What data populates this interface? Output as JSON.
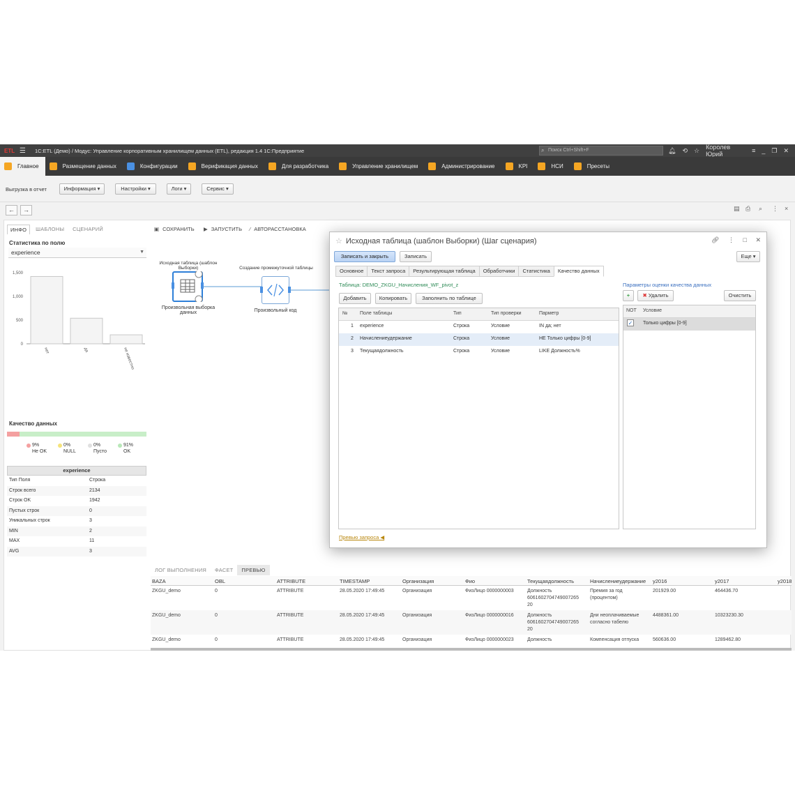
{
  "titlebar": {
    "logo": "ETL",
    "title": "1С:ETL (Демо) / Модус: Управление корпоративным хранилищем данных (ETL), редакция 1.4 1С:Предприятие",
    "search_placeholder": "Поиск Ctrl+Shift+F",
    "user": "Королев Юрий"
  },
  "mainnav": [
    {
      "label": "Главное",
      "icon": "home-icon",
      "color": "#f5a623"
    },
    {
      "label": "Размещение данных",
      "icon": "database-icon",
      "color": "#f5a623"
    },
    {
      "label": "Конфигурации",
      "icon": "hierarchy-icon",
      "color": "#4a90e2"
    },
    {
      "label": "Верификация данных",
      "icon": "wand-icon",
      "color": "#f5a623"
    },
    {
      "label": "Для разработчика",
      "icon": "code-icon",
      "color": "#f5a623"
    },
    {
      "label": "Управление хранилищем",
      "icon": "storage-icon",
      "color": "#f5a623"
    },
    {
      "label": "Администрирование",
      "icon": "gear-icon",
      "color": "#f5a623"
    },
    {
      "label": "KPI",
      "icon": "bar-chart-icon",
      "color": "#f5a623"
    },
    {
      "label": "НСИ",
      "icon": "book-icon",
      "color": "#f5a623"
    },
    {
      "label": "Пресеты",
      "icon": "sliders-icon",
      "color": "#f5a623"
    }
  ],
  "cmdbar": {
    "label": "Выгрузка в отчет",
    "buttons": [
      "Информация ▾",
      "Настройки ▾",
      "Логи ▾",
      "Сервис ▾"
    ]
  },
  "leftpanel": {
    "tabs": [
      "ИНФО",
      "ШАБЛОНЫ",
      "СЦЕНАРИЙ"
    ],
    "field_stats_title": "Статистика по полю",
    "field_selected": "experience",
    "quality_title": "Качество данных",
    "legend": [
      {
        "pct": "9%",
        "label": "Не OK",
        "color": "#f4a0a0"
      },
      {
        "pct": "0%",
        "label": "NULL",
        "color": "#f5e37a"
      },
      {
        "pct": "0%",
        "label": "Пусто",
        "color": "#e0e0e0"
      },
      {
        "pct": "91%",
        "label": "OK",
        "color": "#b8e8b8"
      }
    ],
    "quality_bad_fraction": 0.09,
    "stats_header": "experience",
    "stats": [
      {
        "k": "Тип Поля",
        "v": "Строка"
      },
      {
        "k": "Строк всего",
        "v": "2134"
      },
      {
        "k": "Строк OK",
        "v": "1942"
      },
      {
        "k": "Пустых строк",
        "v": "0"
      },
      {
        "k": "Уникальных строк",
        "v": "3"
      },
      {
        "k": "MIN",
        "v": "2"
      },
      {
        "k": "MAX",
        "v": "11"
      },
      {
        "k": "AVG",
        "v": "3"
      }
    ]
  },
  "chart_data": {
    "type": "bar",
    "categories": [
      "нет",
      "да",
      "не известно"
    ],
    "values": [
      1420,
      540,
      190
    ],
    "yticks": [
      "0",
      "500",
      "1,000",
      "1,500"
    ],
    "ylim": [
      0,
      1500
    ]
  },
  "center": {
    "toolbar": [
      "СОХРАНИТЬ",
      "ЗАПУСТИТЬ",
      "АВТОРАССТАНОВКА"
    ],
    "node1_top": "Исходная таблица (шаблон Выборки)",
    "node1_bottom": "Произвольная выборка данных",
    "node2_top": "Создание промежуточной таблицы",
    "node2_bottom": "Произвольный код"
  },
  "bottom": {
    "tabs": [
      "ЛОГ ВЫПОЛНЕНИЯ",
      "ФАСЕТ",
      "ПРЕВЬЮ"
    ],
    "columns": [
      "BAZA",
      "OBL",
      "ATTRIBUTE",
      "TIMESTAMP",
      "Организация",
      "Фио",
      "Текущаядолжность",
      "Начислениеудержание",
      "y2016",
      "y2017",
      "y2018"
    ],
    "rows": [
      [
        "ZKGU_demo",
        "0",
        "ATTRIBUTE",
        "28.05.2020 17:49:45",
        "Организация",
        "ФизЛицо 0000000003",
        "Должность",
        "6061602704749007265",
        "20",
        "Премия за год",
        "(процентом)",
        "201929.00",
        "464436.70"
      ],
      [
        "ZKGU_demo",
        "0",
        "ATTRIBUTE",
        "28.05.2020 17:49:45",
        "Организация",
        "ФизЛицо 0000000016",
        "Должность",
        "6061602704749007265",
        "20",
        "Дни неоплачиваемые",
        "согласно табелю",
        "4488361.00",
        "10323230.30"
      ],
      [
        "ZKGU_demo",
        "0",
        "ATTRIBUTE",
        "28.05.2020 17:49:45",
        "Организация",
        "ФизЛицо 0000000023",
        "Должность",
        "",
        "",
        "Компенсация отпуска",
        "",
        "560636.00",
        "1289462.80"
      ]
    ]
  },
  "modal": {
    "title": "Исходная таблица (шаблон Выборки) (Шаг сценария)",
    "btn_save_close": "Записать и закрыть",
    "btn_save": "Записать",
    "btn_more": "Еще ▾",
    "tabs": [
      "Основное",
      "Текст запроса",
      "Результирующая таблица",
      "Обработчики",
      "Статистика",
      "Качество данных"
    ],
    "table_link": "Таблица: DEMO_ZKGU_Начисления_WF_pivot_z",
    "btn_add": "Добавить",
    "btn_copy": "Копировать",
    "btn_fill": "Заполнить по таблице",
    "grid_cols": [
      "№",
      "Поле таблицы",
      "Тип",
      "Тип проверки",
      "Парметр"
    ],
    "grid_rows": [
      [
        "1",
        "experience",
        "Строка",
        "Условие",
        "IN да; нет"
      ],
      [
        "2",
        "Начислениеудержание",
        "Строка",
        "Условие",
        "НЕ Только цифры [0-9]"
      ],
      [
        "3",
        "Текущаядолжность",
        "Строка",
        "Условие",
        "LIKE Должность%"
      ]
    ],
    "params_label": "Параметры оценки качества данных",
    "btn_delete": "Удалить",
    "btn_clear": "Очистить",
    "right_cols": [
      "NOT",
      "Условие"
    ],
    "right_row": "Только цифры [0-9]",
    "preview_link": "Превью запроса ◀"
  }
}
